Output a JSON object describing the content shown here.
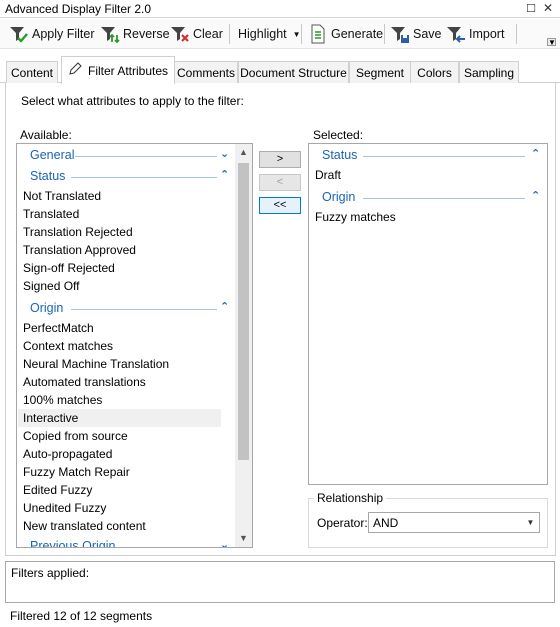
{
  "window": {
    "title": "Advanced Display Filter 2.0"
  },
  "toolbar": {
    "apply": "Apply Filter",
    "reverse": "Reverse",
    "clear": "Clear",
    "highlight": "Highlight",
    "generate": "Generate",
    "save": "Save",
    "import": "Import"
  },
  "tabs": [
    "Content",
    "Filter Attributes",
    "Comments",
    "Document Structure",
    "Segment",
    "Colors",
    "Sampling"
  ],
  "active_tab": "Filter Attributes",
  "filter": {
    "instruction": "Select what attributes to apply to the filter:",
    "available_label": "Available:",
    "selected_label": "Selected:",
    "available_groups": [
      {
        "name": "General",
        "items": []
      },
      {
        "name": "Status",
        "items": [
          "Not Translated",
          "Translated",
          "Translation Rejected",
          "Translation Approved",
          "Sign-off Rejected",
          "Signed Off"
        ]
      },
      {
        "name": "Origin",
        "items": [
          "PerfectMatch",
          "Context matches",
          "Neural Machine Translation",
          "Automated translations",
          "100% matches",
          "Interactive",
          "Copied from source",
          "Auto-propagated",
          "Fuzzy Match Repair",
          "Edited Fuzzy",
          "Unedited Fuzzy",
          "New translated content"
        ]
      },
      {
        "name": "Previous Origin",
        "items": []
      }
    ],
    "selected_available_item": "Interactive",
    "selected_groups": [
      {
        "name": "Status",
        "items": [
          "Draft"
        ]
      },
      {
        "name": "Origin",
        "items": [
          "Fuzzy matches"
        ]
      }
    ],
    "buttons": {
      "add": ">",
      "remove": "<",
      "remove_all": "<<"
    },
    "relationship": {
      "legend": "Relationship",
      "operator_label": "Operator:",
      "operator_value": "AND"
    }
  },
  "status": {
    "filters_applied_label": "Filters applied:",
    "footer": "Filtered 12 of 12 segments"
  },
  "colors": {
    "group_header": "#1a64b6",
    "focus": "#0078d7"
  }
}
